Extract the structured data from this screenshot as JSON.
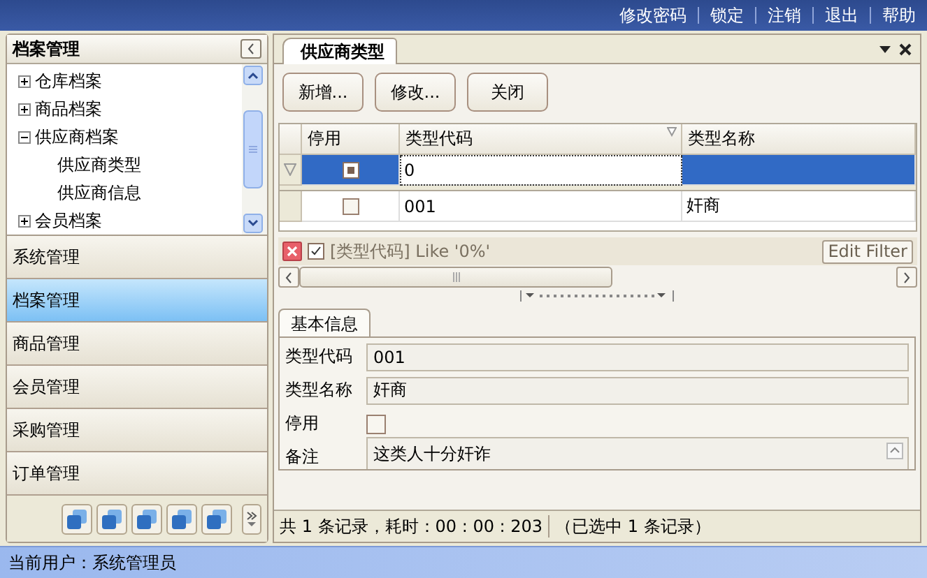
{
  "top_links": [
    "修改密码",
    "锁定",
    "注销",
    "退出",
    "帮助"
  ],
  "sidebar": {
    "title": "档案管理",
    "tree": [
      {
        "label": "仓库档案",
        "expanded": false
      },
      {
        "label": "商品档案",
        "expanded": false
      },
      {
        "label": "供应商档案",
        "expanded": true,
        "children": [
          {
            "label": "供应商类型"
          },
          {
            "label": "供应商信息"
          }
        ]
      },
      {
        "label": "会员档案",
        "expanded": false
      }
    ],
    "nav_items": [
      {
        "label": "系统管理",
        "selected": false
      },
      {
        "label": "档案管理",
        "selected": true
      },
      {
        "label": "商品管理",
        "selected": false
      },
      {
        "label": "会员管理",
        "selected": false
      },
      {
        "label": "采购管理",
        "selected": false
      },
      {
        "label": "订单管理",
        "selected": false
      }
    ]
  },
  "main": {
    "tab": "供应商类型",
    "buttons": [
      "新增...",
      "修改...",
      "关闭"
    ],
    "grid": {
      "columns": [
        "停用",
        "类型代码",
        "类型名称"
      ],
      "rows": [
        {
          "kind": "filter",
          "selected": true,
          "checked": false,
          "indeterminate": true,
          "code": "0"
        },
        {
          "kind": "data",
          "selected": false,
          "checked": false,
          "indeterminate": false,
          "code": "001",
          "name": "奸商"
        }
      ]
    },
    "filter_bar": {
      "active": true,
      "text": "[类型代码] Like '0%'",
      "button": "Edit Filter"
    },
    "detail_tabs": [
      {
        "label": "基本信息",
        "selected": true
      }
    ],
    "form": [
      {
        "kind": "text",
        "label": "类型代码",
        "value": "001"
      },
      {
        "kind": "text",
        "label": "类型名称",
        "value": "奸商"
      },
      {
        "kind": "checkbox",
        "label": "停用",
        "checked": false
      },
      {
        "kind": "memo",
        "label": "备注",
        "value": "这类人十分奸诈"
      }
    ],
    "record_status": [
      "共 1 条记录，耗时：00 : 00 : 203",
      "（已选中 1 条记录）"
    ]
  },
  "status_bar": "当前用户：系统管理员"
}
